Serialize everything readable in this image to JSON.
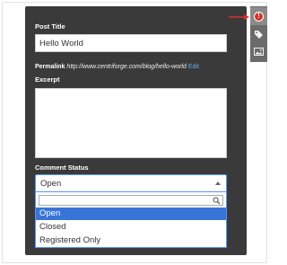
{
  "form": {
    "post_title_label": "Post Title",
    "post_title_value": "Hello World",
    "permalink_label": "Permalink",
    "permalink_url": "http://www.centriforge.com/blog/hello-world",
    "permalink_edit": "Edit",
    "excerpt_label": "Excerpt",
    "excerpt_value": "",
    "comment_status_label": "Comment Status",
    "comment_status_selected": "Open",
    "comment_status_options": [
      "Open",
      "Closed",
      "Registered Only"
    ],
    "search_value": ""
  },
  "sidebar": {
    "buttons": [
      "alert-icon",
      "tag-icon",
      "image-icon"
    ]
  },
  "colors": {
    "panel_bg": "#3a3a3a",
    "selected_option": "#3875d7",
    "focus_border": "#5897fb",
    "alert_red": "#d9302d",
    "arrow_red": "#d9302d"
  }
}
